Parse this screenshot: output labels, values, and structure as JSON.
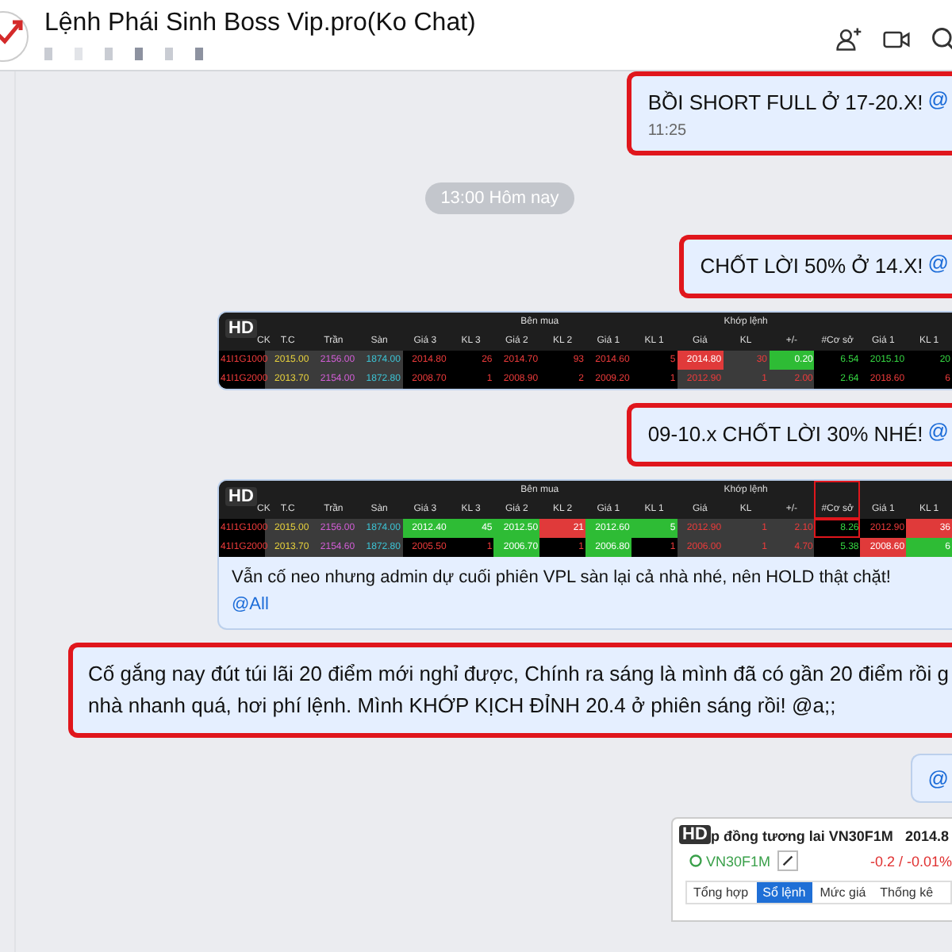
{
  "header": {
    "title": "Lệnh Phái Sinh Boss Vip.pro(Ko Chat)"
  },
  "messages": [
    {
      "kind": "text",
      "highlighted": true,
      "lines": [
        "BỒI SHORT FULL Ở 17-20.X!"
      ],
      "mention": "@",
      "time": "11:25"
    },
    {
      "kind": "divider",
      "text": "13:00 Hôm nay"
    },
    {
      "kind": "text",
      "highlighted": true,
      "lines": [
        "CHỐT LỜI 50% Ở 14.X!"
      ],
      "mention": "@"
    },
    {
      "kind": "table",
      "badge": "HD",
      "headers": [
        {
          "label": "CK",
          "outlined": false
        },
        {
          "label": "T.C",
          "outlined": false
        },
        {
          "label": "Trần",
          "outlined": false
        },
        {
          "label": "Sàn",
          "outlined": false
        },
        {
          "label": "Bên mua",
          "columns": [
            {
              "label": "Giá 3",
              "outlined": false
            },
            {
              "label": "KL 3",
              "outlined": false
            },
            {
              "label": "Giá 2",
              "outlined": false
            },
            {
              "label": "KL 2",
              "outlined": false
            },
            {
              "label": "Giá 1",
              "outlined": false
            },
            {
              "label": "KL 1",
              "outlined": false
            }
          ]
        },
        {
          "label": "Khớp lệnh",
          "columns": [
            {
              "label": "Giá",
              "outlined": false
            },
            {
              "label": "KL",
              "outlined": false
            },
            {
              "label": "+/-",
              "outlined": false
            }
          ]
        },
        {
          "label": "#Cơ sở",
          "outlined": false
        },
        {
          "label": "Giá 1",
          "outlined": false
        },
        {
          "label": "KL 1",
          "outlined": false
        }
      ],
      "rows": [
        [
          {
            "v": "41I1G1000",
            "kind": "red"
          },
          {
            "v": "2015.00",
            "kind": "yellow"
          },
          {
            "v": "2156.00",
            "kind": "purple"
          },
          {
            "v": "1874.00",
            "kind": "cyan"
          },
          {
            "v": "2014.80",
            "kind": "red"
          },
          {
            "v": "26",
            "kind": "red"
          },
          {
            "v": "2014.70",
            "kind": "red"
          },
          {
            "v": "93",
            "kind": "red"
          },
          {
            "v": "2014.60",
            "kind": "red"
          },
          {
            "v": "5",
            "kind": "red"
          },
          {
            "v": "2014.80",
            "kind": "redfill"
          },
          {
            "v": "30",
            "kind": "redgray"
          },
          {
            "v": "0.20",
            "kind": "greenfill"
          },
          {
            "v": "6.54",
            "kind": "green"
          },
          {
            "v": "2015.10",
            "kind": "green"
          },
          {
            "v": "20",
            "kind": "green"
          }
        ],
        [
          {
            "v": "41I1G2000",
            "kind": "red"
          },
          {
            "v": "2013.70",
            "kind": "yellow"
          },
          {
            "v": "2154.00",
            "kind": "purple"
          },
          {
            "v": "1872.80",
            "kind": "cyan"
          },
          {
            "v": "2008.70",
            "kind": "red"
          },
          {
            "v": "1",
            "kind": "red"
          },
          {
            "v": "2008.90",
            "kind": "red"
          },
          {
            "v": "2",
            "kind": "red"
          },
          {
            "v": "2009.20",
            "kind": "red"
          },
          {
            "v": "1",
            "kind": "red"
          },
          {
            "v": "2012.90",
            "kind": "redgray"
          },
          {
            "v": "1",
            "kind": "redgray"
          },
          {
            "v": "2.00",
            "kind": "redgray"
          },
          {
            "v": "2.64",
            "kind": "green"
          },
          {
            "v": "2018.60",
            "kind": "red"
          },
          {
            "v": "6",
            "kind": "red"
          }
        ]
      ]
    },
    {
      "kind": "text",
      "highlighted": true,
      "lines": [
        "09-10.x CHỐT LỜI 30% NHÉ!"
      ],
      "mention": "@"
    },
    {
      "kind": "table",
      "badge": "HD",
      "headers": [
        {
          "label": "CK",
          "outlined": false
        },
        {
          "label": "T.C",
          "outlined": false
        },
        {
          "label": "Trần",
          "outlined": false
        },
        {
          "label": "Sàn",
          "outlined": false
        },
        {
          "label": "Bên mua",
          "columns": [
            {
              "label": "Giá 3",
              "outlined": false
            },
            {
              "label": "KL 3",
              "outlined": false
            },
            {
              "label": "Giá 2",
              "outlined": false
            },
            {
              "label": "KL 2",
              "outlined": false
            },
            {
              "label": "Giá 1",
              "outlined": false
            },
            {
              "label": "KL 1",
              "outlined": false
            }
          ]
        },
        {
          "label": "Khớp lệnh",
          "columns": [
            {
              "label": "Giá",
              "outlined": false
            },
            {
              "label": "KL",
              "outlined": false
            },
            {
              "label": "+/-",
              "outlined": false
            }
          ]
        },
        {
          "label": "#Cơ sở",
          "outlined": true
        },
        {
          "label": "Giá 1",
          "outlined": false
        },
        {
          "label": "KL 1",
          "outlined": false
        }
      ],
      "rows": [
        [
          {
            "v": "41I1G1000",
            "kind": "red",
            "outlined": false
          },
          {
            "v": "2015.00",
            "kind": "yellow",
            "outlined": false
          },
          {
            "v": "2156.00",
            "kind": "purple",
            "outlined": false
          },
          {
            "v": "1874.00",
            "kind": "cyan",
            "outlined": false
          },
          {
            "v": "2012.40",
            "kind": "greenfill",
            "outlined": false
          },
          {
            "v": "45",
            "kind": "greenfill",
            "outlined": false
          },
          {
            "v": "2012.50",
            "kind": "greenfill",
            "outlined": false
          },
          {
            "v": "21",
            "kind": "redfill",
            "outlined": false
          },
          {
            "v": "2012.60",
            "kind": "greenfill",
            "outlined": false
          },
          {
            "v": "5",
            "kind": "greenfill",
            "outlined": false
          },
          {
            "v": "2012.90",
            "kind": "redgray",
            "outlined": false
          },
          {
            "v": "1",
            "kind": "redgray",
            "outlined": false
          },
          {
            "v": "2.10",
            "kind": "redgray",
            "outlined": false
          },
          {
            "v": "8.26",
            "kind": "green",
            "outlined": true
          },
          {
            "v": "2012.90",
            "kind": "red",
            "outlined": false
          },
          {
            "v": "36",
            "kind": "redfill",
            "outlined": false
          }
        ],
        [
          {
            "v": "41I1G2000",
            "kind": "red",
            "outlined": false
          },
          {
            "v": "2013.70",
            "kind": "yellow",
            "outlined": false
          },
          {
            "v": "2154.60",
            "kind": "purple",
            "outlined": false
          },
          {
            "v": "1872.80",
            "kind": "cyan",
            "outlined": false
          },
          {
            "v": "2005.50",
            "kind": "red",
            "outlined": false
          },
          {
            "v": "1",
            "kind": "red",
            "outlined": false
          },
          {
            "v": "2006.70",
            "kind": "greenfill",
            "outlined": false
          },
          {
            "v": "1",
            "kind": "red",
            "outlined": false
          },
          {
            "v": "2006.80",
            "kind": "greenfill",
            "outlined": false
          },
          {
            "v": "1",
            "kind": "red",
            "outlined": false
          },
          {
            "v": "2006.00",
            "kind": "redgray",
            "outlined": false
          },
          {
            "v": "1",
            "kind": "redgray",
            "outlined": false
          },
          {
            "v": "4.70",
            "kind": "redgray",
            "outlined": false
          },
          {
            "v": "5.38",
            "kind": "green",
            "outlined": false
          },
          {
            "v": "2008.60",
            "kind": "redfill",
            "outlined": false
          },
          {
            "v": "6",
            "kind": "greenfill",
            "outlined": false
          }
        ]
      ],
      "caption": "Vẫn cố neo nhưng admin dự cuối phiên VPL sàn lại cả nhà nhé, nên HOLD thật chặt!",
      "caption_mention": "@All"
    },
    {
      "kind": "text",
      "highlighted": true,
      "lines": [
        "Cố gắng nay đút túi lãi 20 điểm mới nghỉ được, Chính ra sáng là mình đã có gần 20 điểm rồi g",
        "nhà nhanh quá, hơi phí lệnh. Mình KHỚP KỊCH ĐỈNH 20.4 ở phiên sáng rồi! @a;;"
      ]
    },
    {
      "kind": "text",
      "highlighted": false,
      "mention": "@"
    },
    {
      "kind": "quote",
      "badge": "HD",
      "title": "p đồng tương lai VN30F1M",
      "price": "2014.8",
      "symbol": "VN30F1M",
      "change": "-0.2 / -0.01%",
      "tabs": [
        {
          "label": "Tổng hợp",
          "selected": false
        },
        {
          "label": "Sổ lệnh",
          "selected": true
        },
        {
          "label": "Mức giá",
          "selected": false
        },
        {
          "label": "Thống kê",
          "selected": false
        }
      ]
    }
  ]
}
